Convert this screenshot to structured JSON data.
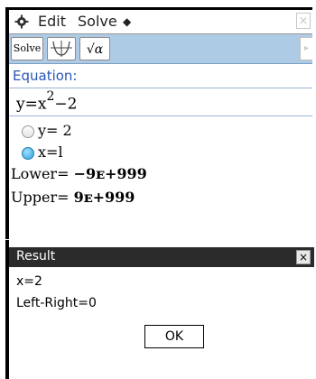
{
  "menubar": {
    "items": [
      {
        "label": "Edit"
      },
      {
        "label": "Solve"
      }
    ],
    "dropdown_glyph": "◆",
    "close_glyph": "×"
  },
  "toolbar": {
    "solve_label": "Solve",
    "sqrt_label": "√α",
    "scroll_glyph": "▸"
  },
  "equation": {
    "label": "Equation:",
    "text_base": "y=x",
    "text_exp": "2",
    "text_tail": "−2"
  },
  "variables": [
    {
      "label": "y=",
      "value": "2",
      "selected": false
    },
    {
      "label": "x=",
      "value": "l",
      "selected": true
    }
  ],
  "bounds": {
    "lower_label": "Lower=",
    "lower_value": "−9ᴇ+999",
    "upper_label": "Upper=",
    "upper_value": "9ᴇ+999"
  },
  "result": {
    "title": "Result",
    "close_glyph": "×",
    "lines": [
      "x=2",
      "Left-Right=0"
    ],
    "ok_label": "OK"
  },
  "colors": {
    "accent_blue": "#2a55b8",
    "toolbar_bg": "#aecbe6",
    "result_bar": "#2b2b2b"
  }
}
